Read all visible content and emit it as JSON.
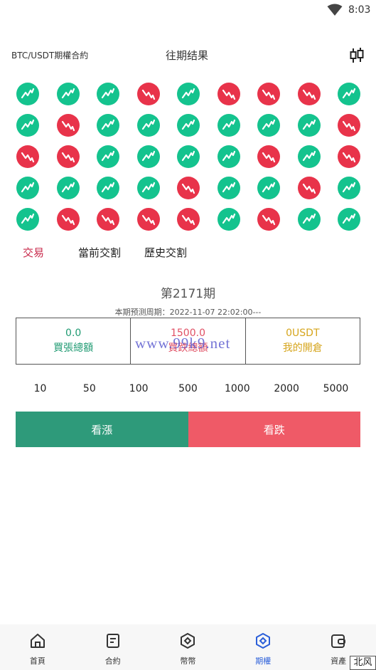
{
  "status_bar": {
    "time": "8:03",
    "wifi_icon": "wifi-icon"
  },
  "header": {
    "contract_label": "BTC/USDT期權合約",
    "past_results_label": "往期结果",
    "chart_icon": "candlestick-icon"
  },
  "results_grid": [
    [
      "up",
      "up",
      "up",
      "down",
      "up",
      "down",
      "down",
      "down",
      "up"
    ],
    [
      "up",
      "down",
      "up",
      "up",
      "up",
      "up",
      "up",
      "up",
      "down"
    ],
    [
      "down",
      "down",
      "up",
      "up",
      "up",
      "up",
      "down",
      "up",
      "down"
    ],
    [
      "up",
      "up",
      "up",
      "up",
      "down",
      "up",
      "up",
      "down",
      "up"
    ],
    [
      "up",
      "down",
      "down",
      "down",
      "down",
      "up",
      "down",
      "up",
      "up"
    ]
  ],
  "colors": {
    "up": "#14c38e",
    "down": "#e8334a",
    "active_tab": "#c8284a",
    "buy_up": "#2e9a7a",
    "buy_down": "#ef5a67",
    "nav_active": "#2b5fd9"
  },
  "tabs": [
    {
      "label": "交易",
      "active": true
    },
    {
      "label": "當前交割",
      "active": false
    },
    {
      "label": "歷史交割",
      "active": false
    }
  ],
  "period": {
    "title": "第2171期",
    "forecast": "本期预测周期：2022-11-07 22:02:00---"
  },
  "summary": {
    "buy_up_value": "0.0",
    "buy_up_label": "買張總額",
    "buy_down_value": "1500.0",
    "buy_down_label": "買跌總額",
    "my_position_value": "0USDT",
    "my_position_label": "我的開倉"
  },
  "watermark": "www.99k9.net",
  "amounts": [
    "10",
    "50",
    "100",
    "500",
    "1000",
    "2000",
    "5000"
  ],
  "actions": {
    "buy_up": "看漲",
    "buy_down": "看跌"
  },
  "bottom_nav": [
    {
      "label": "首頁",
      "icon": "home-icon",
      "active": false
    },
    {
      "label": "合約",
      "icon": "contract-icon",
      "active": false
    },
    {
      "label": "幣幣",
      "icon": "coin-icon",
      "active": false
    },
    {
      "label": "期權",
      "icon": "options-icon",
      "active": true
    },
    {
      "label": "資產",
      "icon": "wallet-icon",
      "active": false
    }
  ],
  "corner_mark": "北风"
}
